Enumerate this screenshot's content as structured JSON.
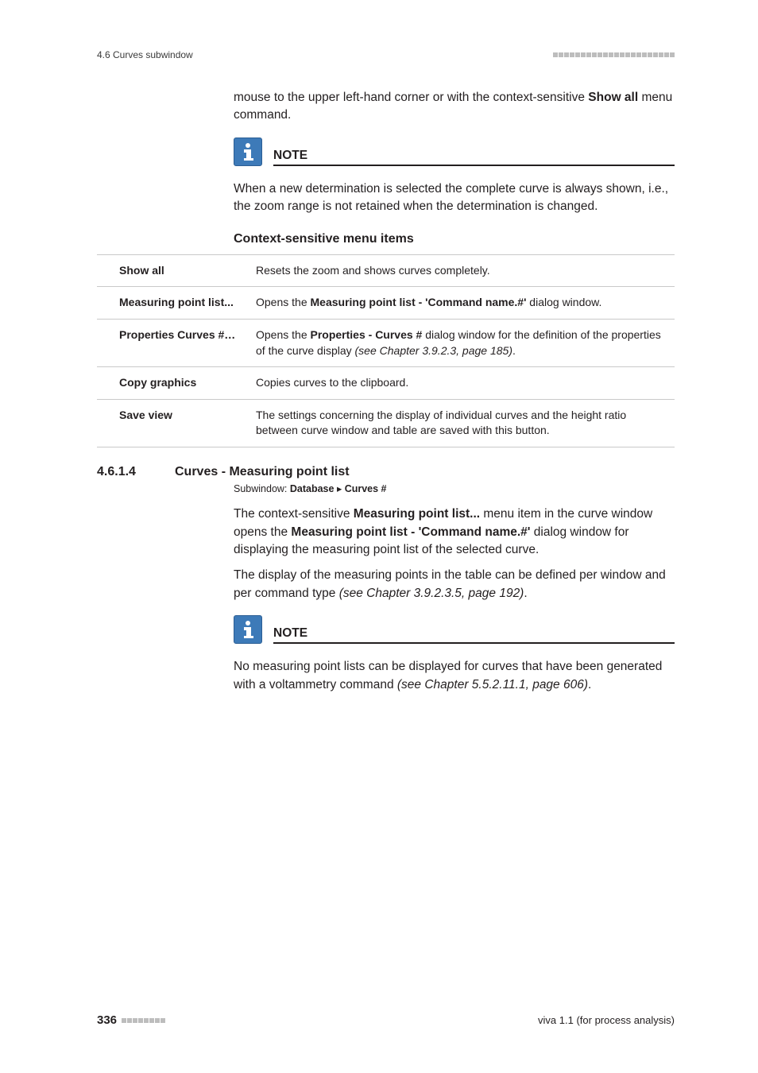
{
  "header": {
    "left": "4.6 Curves subwindow"
  },
  "intro": {
    "line1_a": "mouse to the upper left-hand corner or with the context-sensitive ",
    "line1_b": "Show all",
    "line1_c": " menu command."
  },
  "note1": {
    "title": "NOTE",
    "text": "When a new determination is selected the complete curve is always shown, i.e., the zoom range is not retained when the determination is changed."
  },
  "context": {
    "heading": "Context-sensitive menu items",
    "rows": [
      {
        "label": "Show all",
        "desc_plain": "Resets the zoom and shows curves completely."
      },
      {
        "label": "Measuring point list...",
        "desc_a": "Opens the ",
        "desc_b": "Measuring point list - 'Command name.#'",
        "desc_c": " dialog window."
      },
      {
        "label": "Properties Curves #…",
        "desc_a": "Opens the ",
        "desc_b": "Properties - Curves #",
        "desc_c": " dialog window for the definition of the properties of the curve display ",
        "desc_i": "(see Chapter 3.9.2.3, page 185)",
        "desc_d": "."
      },
      {
        "label": "Copy graphics",
        "desc_plain": "Copies curves to the clipboard."
      },
      {
        "label": "Save view",
        "desc_plain": "The settings concerning the display of individual curves and the height ratio between curve window and table are saved with this button."
      }
    ]
  },
  "section": {
    "num": "4.6.1.4",
    "title": "Curves - Measuring point list",
    "sub_a": "Subwindow: ",
    "sub_b": "Database",
    "sub_sep": " ▸ ",
    "sub_c": "Curves #",
    "p1_a": "The context-sensitive ",
    "p1_b": "Measuring point list...",
    "p1_c": " menu item in the curve window opens the ",
    "p1_d": "Measuring point list - 'Command name.#'",
    "p1_e": " dialog window for displaying the measuring point list of the selected curve.",
    "p2_a": "The display of the measuring points in the table can be defined per window and per command type ",
    "p2_i": "(see Chapter 3.9.2.3.5, page 192)",
    "p2_b": "."
  },
  "note2": {
    "title": "NOTE",
    "text_a": "No measuring point lists can be displayed for curves that have been generated with a voltammetry command ",
    "text_i": "(see Chapter 5.5.2.11.1, page 606)",
    "text_b": "."
  },
  "footer": {
    "page": "336",
    "right": "viva 1.1 (for process analysis)"
  }
}
